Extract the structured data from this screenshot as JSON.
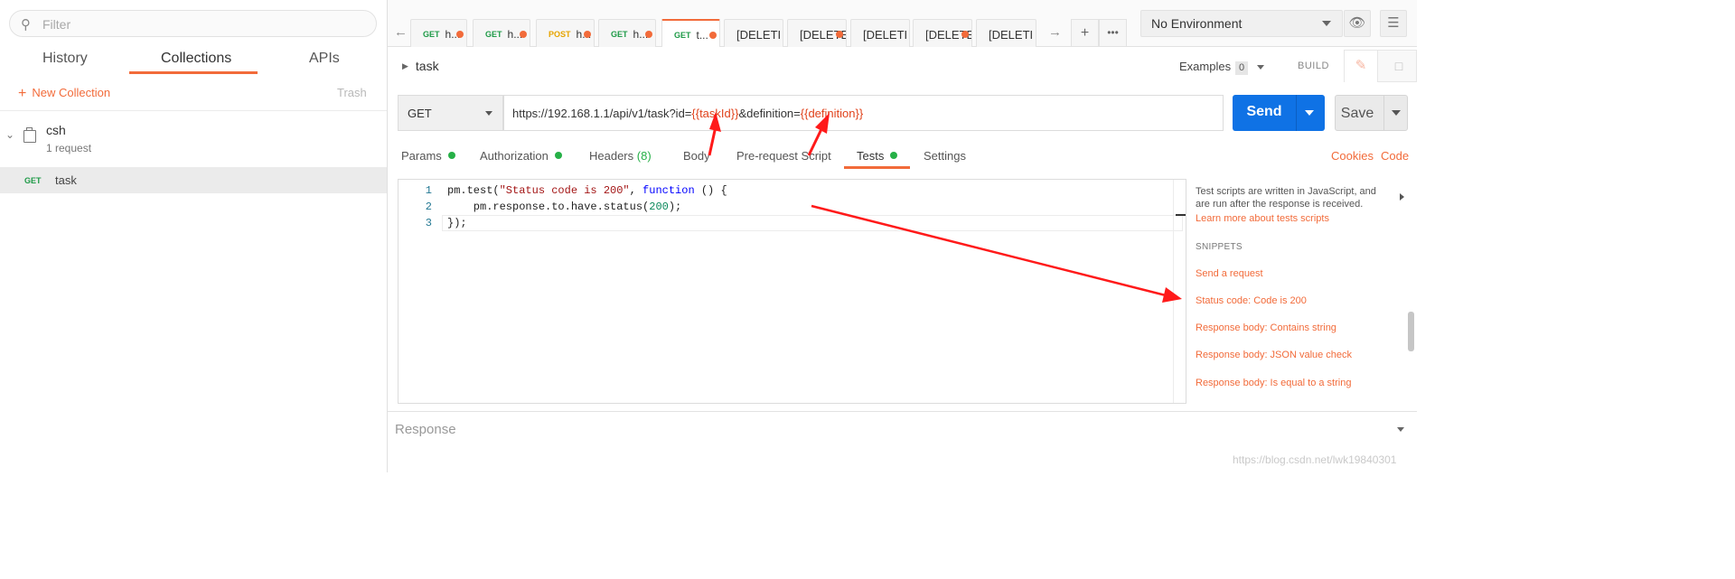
{
  "sidebar": {
    "filter_placeholder": "Filter",
    "tabs": [
      {
        "label": "History"
      },
      {
        "label": "Collections"
      },
      {
        "label": "APIs"
      }
    ],
    "new_collection": "New Collection",
    "trash": "Trash",
    "collection": {
      "name": "csh",
      "count": "1 request"
    },
    "request": {
      "method": "GET",
      "name": "task"
    }
  },
  "tabs": [
    {
      "method": "GET",
      "title": "h...",
      "dirty": true
    },
    {
      "method": "GET",
      "title": "h...",
      "dirty": true
    },
    {
      "method": "POST",
      "title": "h...",
      "dirty": true
    },
    {
      "method": "GET",
      "title": "h...",
      "dirty": true
    },
    {
      "method": "GET",
      "title": "t...",
      "dirty": true,
      "active": true
    },
    {
      "method": "",
      "title": "[DELETI",
      "dirty": false
    },
    {
      "method": "",
      "title": "[DELETE",
      "dirty": true
    },
    {
      "method": "",
      "title": "[DELETI",
      "dirty": false
    },
    {
      "method": "",
      "title": "[DELETE",
      "dirty": true
    },
    {
      "method": "",
      "title": "[DELETI",
      "dirty": false
    }
  ],
  "environment": {
    "selected": "No Environment"
  },
  "request": {
    "title": "task",
    "examples_label": "Examples",
    "examples_count": "0",
    "build_label": "BUILD",
    "method": "GET",
    "url_parts": [
      {
        "text": "https://192.168.1.1/api/v1/task?id=",
        "var": false
      },
      {
        "text": "{{taskId}}",
        "var": true
      },
      {
        "text": "&definition=",
        "var": false
      },
      {
        "text": "{{definition}}",
        "var": true
      }
    ],
    "send_label": "Send",
    "save_label": "Save"
  },
  "subtabs": {
    "params": "Params",
    "authorization": "Authorization",
    "headers": "Headers",
    "headers_count": "(8)",
    "body": "Body",
    "prerequest": "Pre-request Script",
    "tests": "Tests",
    "settings": "Settings",
    "cookies": "Cookies",
    "code": "Code"
  },
  "editor": {
    "lines": [
      {
        "n": "1",
        "html_parts": [
          [
            "",
            "pm.test("
          ],
          [
            "str",
            "\"Status code is 200\""
          ],
          [
            "",
            ", "
          ],
          [
            "kw",
            "function"
          ],
          [
            "",
            " () {"
          ]
        ]
      },
      {
        "n": "2",
        "html_parts": [
          [
            "",
            "    pm.response.to.have.status("
          ],
          [
            "num",
            "200"
          ],
          [
            "",
            ");"
          ]
        ]
      },
      {
        "n": "3",
        "html_parts": [
          [
            "",
            "});"
          ]
        ]
      }
    ]
  },
  "snippets": {
    "description": "Test scripts are written in JavaScript, and are run after the response is received.",
    "learn_more": "Learn more about tests scripts",
    "heading": "SNIPPETS",
    "items": [
      "Send a request",
      "Status code: Code is 200",
      "Response body: Contains string",
      "Response body: JSON value check",
      "Response body: Is equal to a string"
    ]
  },
  "response": {
    "label": "Response"
  },
  "watermark": "https://blog.csdn.net/lwk19840301",
  "colors": {
    "accent": "#f26b3a",
    "send": "#0f72e5",
    "get": "#1e9a47",
    "post": "#e6a400",
    "annotation": "#ff1a1a"
  }
}
